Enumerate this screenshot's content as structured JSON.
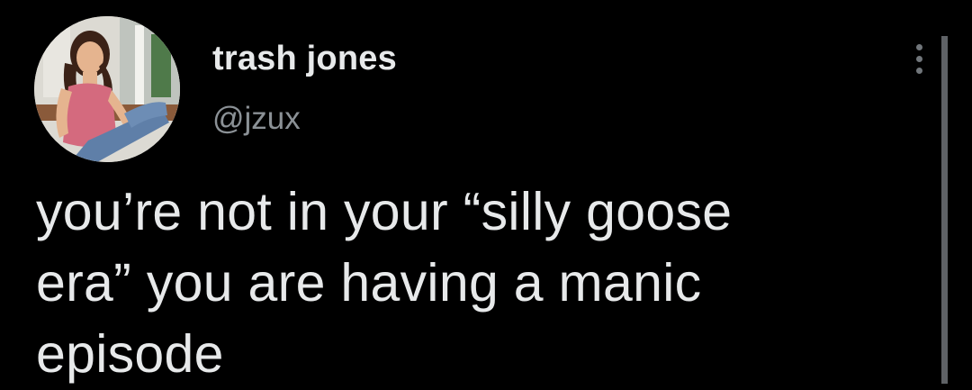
{
  "tweet": {
    "author": {
      "display_name": "trash jones",
      "handle": "@jzux",
      "avatar_icon": "profile-photo"
    },
    "more_icon": "more-vertical-icon",
    "text_lines": [
      "you’re not in your “silly goose",
      "era” you are having a manic",
      "episode"
    ]
  },
  "colors": {
    "background": "#000000",
    "primary_text": "#e7e9ea",
    "secondary_text": "#8b9196",
    "icon": "#71767b"
  }
}
